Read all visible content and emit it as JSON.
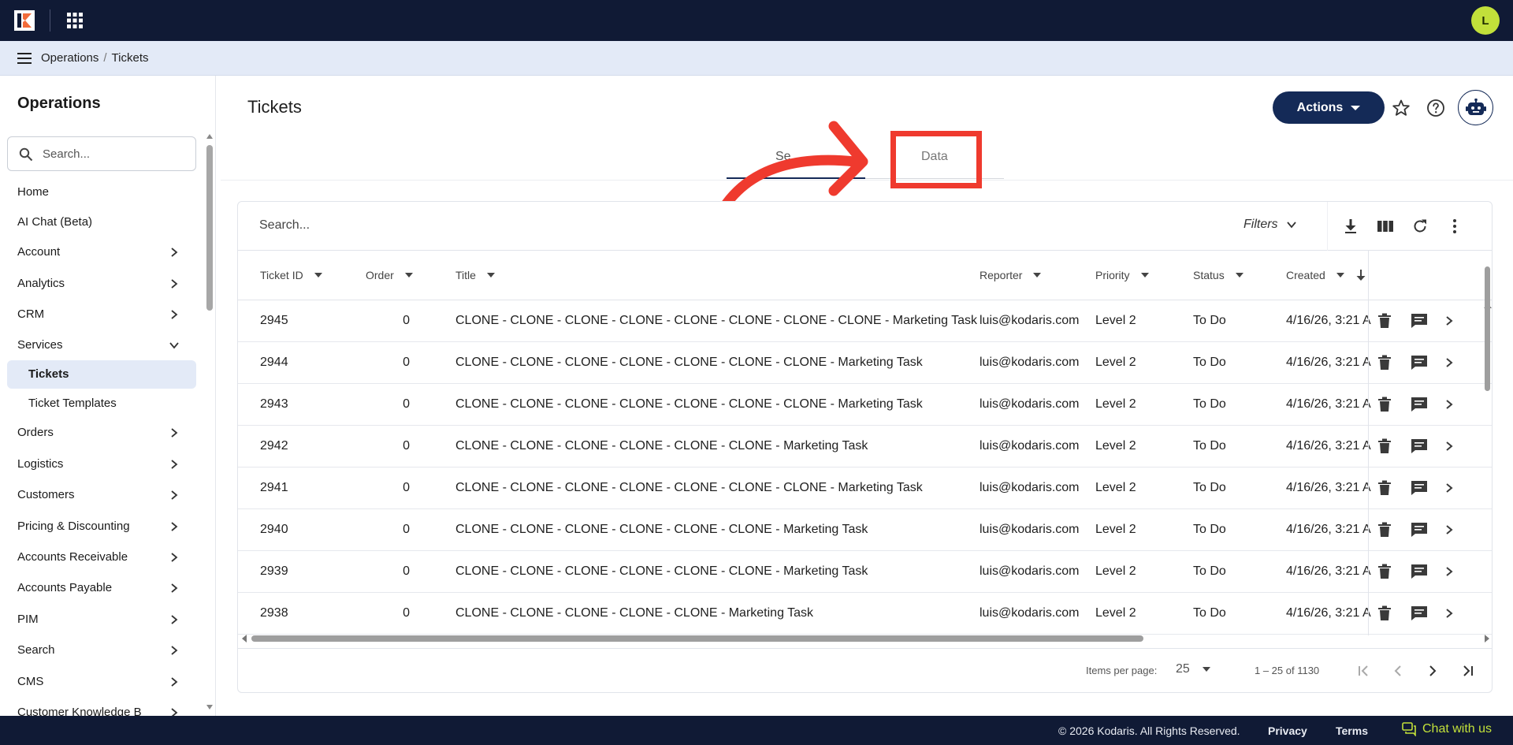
{
  "colors": {
    "topbar": "#101a35",
    "accent": "#142a57",
    "highlight": "#ef3a2e",
    "avatar": "#c2e03a"
  },
  "header": {
    "avatar_initial": "L"
  },
  "breadcrumb": {
    "section": "Operations",
    "separator": "/",
    "page": "Tickets"
  },
  "sidebar": {
    "title": "Operations",
    "search_placeholder": "Search...",
    "items": [
      {
        "label": "Home"
      },
      {
        "label": "AI Chat (Beta)"
      },
      {
        "label": "Account",
        "icon": "chevron-right-icon"
      },
      {
        "label": "Analytics",
        "icon": "chevron-right-icon"
      },
      {
        "label": "CRM",
        "icon": "chevron-right-icon"
      },
      {
        "label": "Services",
        "icon": "chevron-down-icon"
      },
      {
        "label": "Tickets",
        "active": true
      },
      {
        "label": "Ticket Templates"
      },
      {
        "label": "Orders",
        "icon": "chevron-right-icon"
      },
      {
        "label": "Logistics",
        "icon": "chevron-right-icon"
      },
      {
        "label": "Customers",
        "icon": "chevron-right-icon"
      },
      {
        "label": "Pricing & Discounting",
        "icon": "chevron-right-icon"
      },
      {
        "label": "Accounts Receivable",
        "icon": "chevron-right-icon"
      },
      {
        "label": "Accounts Payable",
        "icon": "chevron-right-icon"
      },
      {
        "label": "PIM",
        "icon": "chevron-right-icon"
      },
      {
        "label": "Search",
        "icon": "chevron-right-icon"
      },
      {
        "label": "CMS",
        "icon": "chevron-right-icon"
      },
      {
        "label": "Customer Knowledge B",
        "icon": "chevron-right-icon"
      }
    ]
  },
  "main": {
    "title": "Tickets",
    "actions_label": "Actions",
    "tabs": [
      {
        "label": "Se"
      },
      {
        "label": "Data"
      }
    ]
  },
  "table": {
    "search_placeholder": "Search...",
    "filters_label": "Filters",
    "columns": [
      "Ticket ID",
      "Order",
      "Title",
      "Reporter",
      "Priority",
      "Status",
      "Created"
    ],
    "rows": [
      {
        "id": "2945",
        "order": "0",
        "title": "CLONE - CLONE - CLONE - CLONE - CLONE - CLONE - CLONE - CLONE - Marketing Task",
        "reporter": "luis@kodaris.com",
        "priority": "Level 2",
        "status": "To Do",
        "created": "4/16/26, 3:21 A"
      },
      {
        "id": "2944",
        "order": "0",
        "title": "CLONE - CLONE - CLONE - CLONE - CLONE - CLONE - CLONE - Marketing Task",
        "reporter": "luis@kodaris.com",
        "priority": "Level 2",
        "status": "To Do",
        "created": "4/16/26, 3:21 A"
      },
      {
        "id": "2943",
        "order": "0",
        "title": "CLONE - CLONE - CLONE - CLONE - CLONE - CLONE - CLONE - Marketing Task",
        "reporter": "luis@kodaris.com",
        "priority": "Level 2",
        "status": "To Do",
        "created": "4/16/26, 3:21 A"
      },
      {
        "id": "2942",
        "order": "0",
        "title": "CLONE - CLONE - CLONE - CLONE - CLONE - CLONE - Marketing Task",
        "reporter": "luis@kodaris.com",
        "priority": "Level 2",
        "status": "To Do",
        "created": "4/16/26, 3:21 A"
      },
      {
        "id": "2941",
        "order": "0",
        "title": "CLONE - CLONE - CLONE - CLONE - CLONE - CLONE - CLONE - Marketing Task",
        "reporter": "luis@kodaris.com",
        "priority": "Level 2",
        "status": "To Do",
        "created": "4/16/26, 3:21 A"
      },
      {
        "id": "2940",
        "order": "0",
        "title": "CLONE - CLONE - CLONE - CLONE - CLONE - CLONE - Marketing Task",
        "reporter": "luis@kodaris.com",
        "priority": "Level 2",
        "status": "To Do",
        "created": "4/16/26, 3:21 A"
      },
      {
        "id": "2939",
        "order": "0",
        "title": "CLONE - CLONE - CLONE - CLONE - CLONE - CLONE - Marketing Task",
        "reporter": "luis@kodaris.com",
        "priority": "Level 2",
        "status": "To Do",
        "created": "4/16/26, 3:21 A"
      },
      {
        "id": "2938",
        "order": "0",
        "title": "CLONE - CLONE - CLONE - CLONE - CLONE - Marketing Task",
        "reporter": "luis@kodaris.com",
        "priority": "Level 2",
        "status": "To Do",
        "created": "4/16/26, 3:21 A"
      }
    ],
    "pager": {
      "items_per_page_label": "Items per page:",
      "page_size": "25",
      "range": "1 – 25 of 1130"
    }
  },
  "footer": {
    "copyright": "© 2026 Kodaris. All Rights Reserved.",
    "privacy": "Privacy",
    "terms": "Terms",
    "chat": "Chat with us"
  }
}
